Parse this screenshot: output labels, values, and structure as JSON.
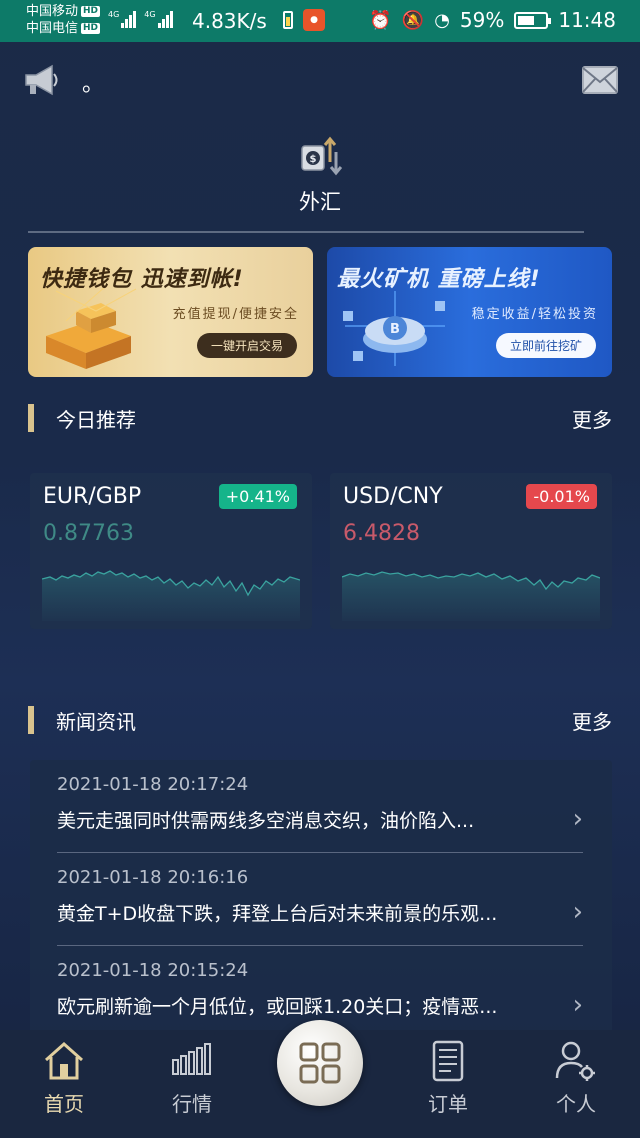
{
  "status_bar": {
    "carrier_1": "中国移动",
    "carrier_2": "中国电信",
    "hd_badge": "HD",
    "network": "4G",
    "speed": "4.83K/s",
    "battery_percent": "59%",
    "time": "11:48",
    "icons": [
      "alarm-icon",
      "mute-icon",
      "speedometer-icon"
    ]
  },
  "notice": {
    "text": "。",
    "speaker_icon": "megaphone-icon",
    "mail_icon": "envelope-icon"
  },
  "forex": {
    "label": "外汇",
    "icon": "currency-exchange-icon"
  },
  "banners": [
    {
      "title": "快捷钱包 迅速到帐!",
      "subtitle": "充值提现/便捷安全",
      "button": "一键开启交易"
    },
    {
      "title": "最火矿机 重磅上线!",
      "subtitle": "稳定收益/轻松投资",
      "button": "立即前往挖矿"
    }
  ],
  "recommend": {
    "title": "今日推荐",
    "more": "更多",
    "cards": [
      {
        "pair": "EUR/GBP",
        "change": "+0.41%",
        "price": "0.87763",
        "direction": "up",
        "color": "#15b48a"
      },
      {
        "pair": "USD/CNY",
        "change": "-0.01%",
        "price": "6.4828",
        "direction": "down",
        "color": "#e5484d"
      }
    ]
  },
  "news": {
    "title": "新闻资讯",
    "more": "更多",
    "items": [
      {
        "time": "2021-01-18 20:17:24",
        "title": "美元走强同时供需两线多空消息交织，油价陷入..."
      },
      {
        "time": "2021-01-18 20:16:16",
        "title": "黄金T+D收盘下跌，拜登上台后对未来前景的乐观..."
      },
      {
        "time": "2021-01-18 20:15:24",
        "title": "欧元刷新逾一个月低位，或回踩1.20关口；疫情恶..."
      }
    ]
  },
  "tabbar": {
    "items": [
      {
        "label": "首页",
        "icon": "home-icon",
        "active": true
      },
      {
        "label": "行情",
        "icon": "market-chart-icon",
        "active": false
      },
      {
        "label": "",
        "icon": "grid-icon",
        "active": false
      },
      {
        "label": "订单",
        "icon": "order-list-icon",
        "active": false
      },
      {
        "label": "个人",
        "icon": "user-settings-icon",
        "active": false
      }
    ]
  },
  "colors": {
    "accent_gold": "#d9c38e",
    "up_green": "#15b48a",
    "down_red": "#e5484d",
    "status_bar": "#0d7a68"
  }
}
